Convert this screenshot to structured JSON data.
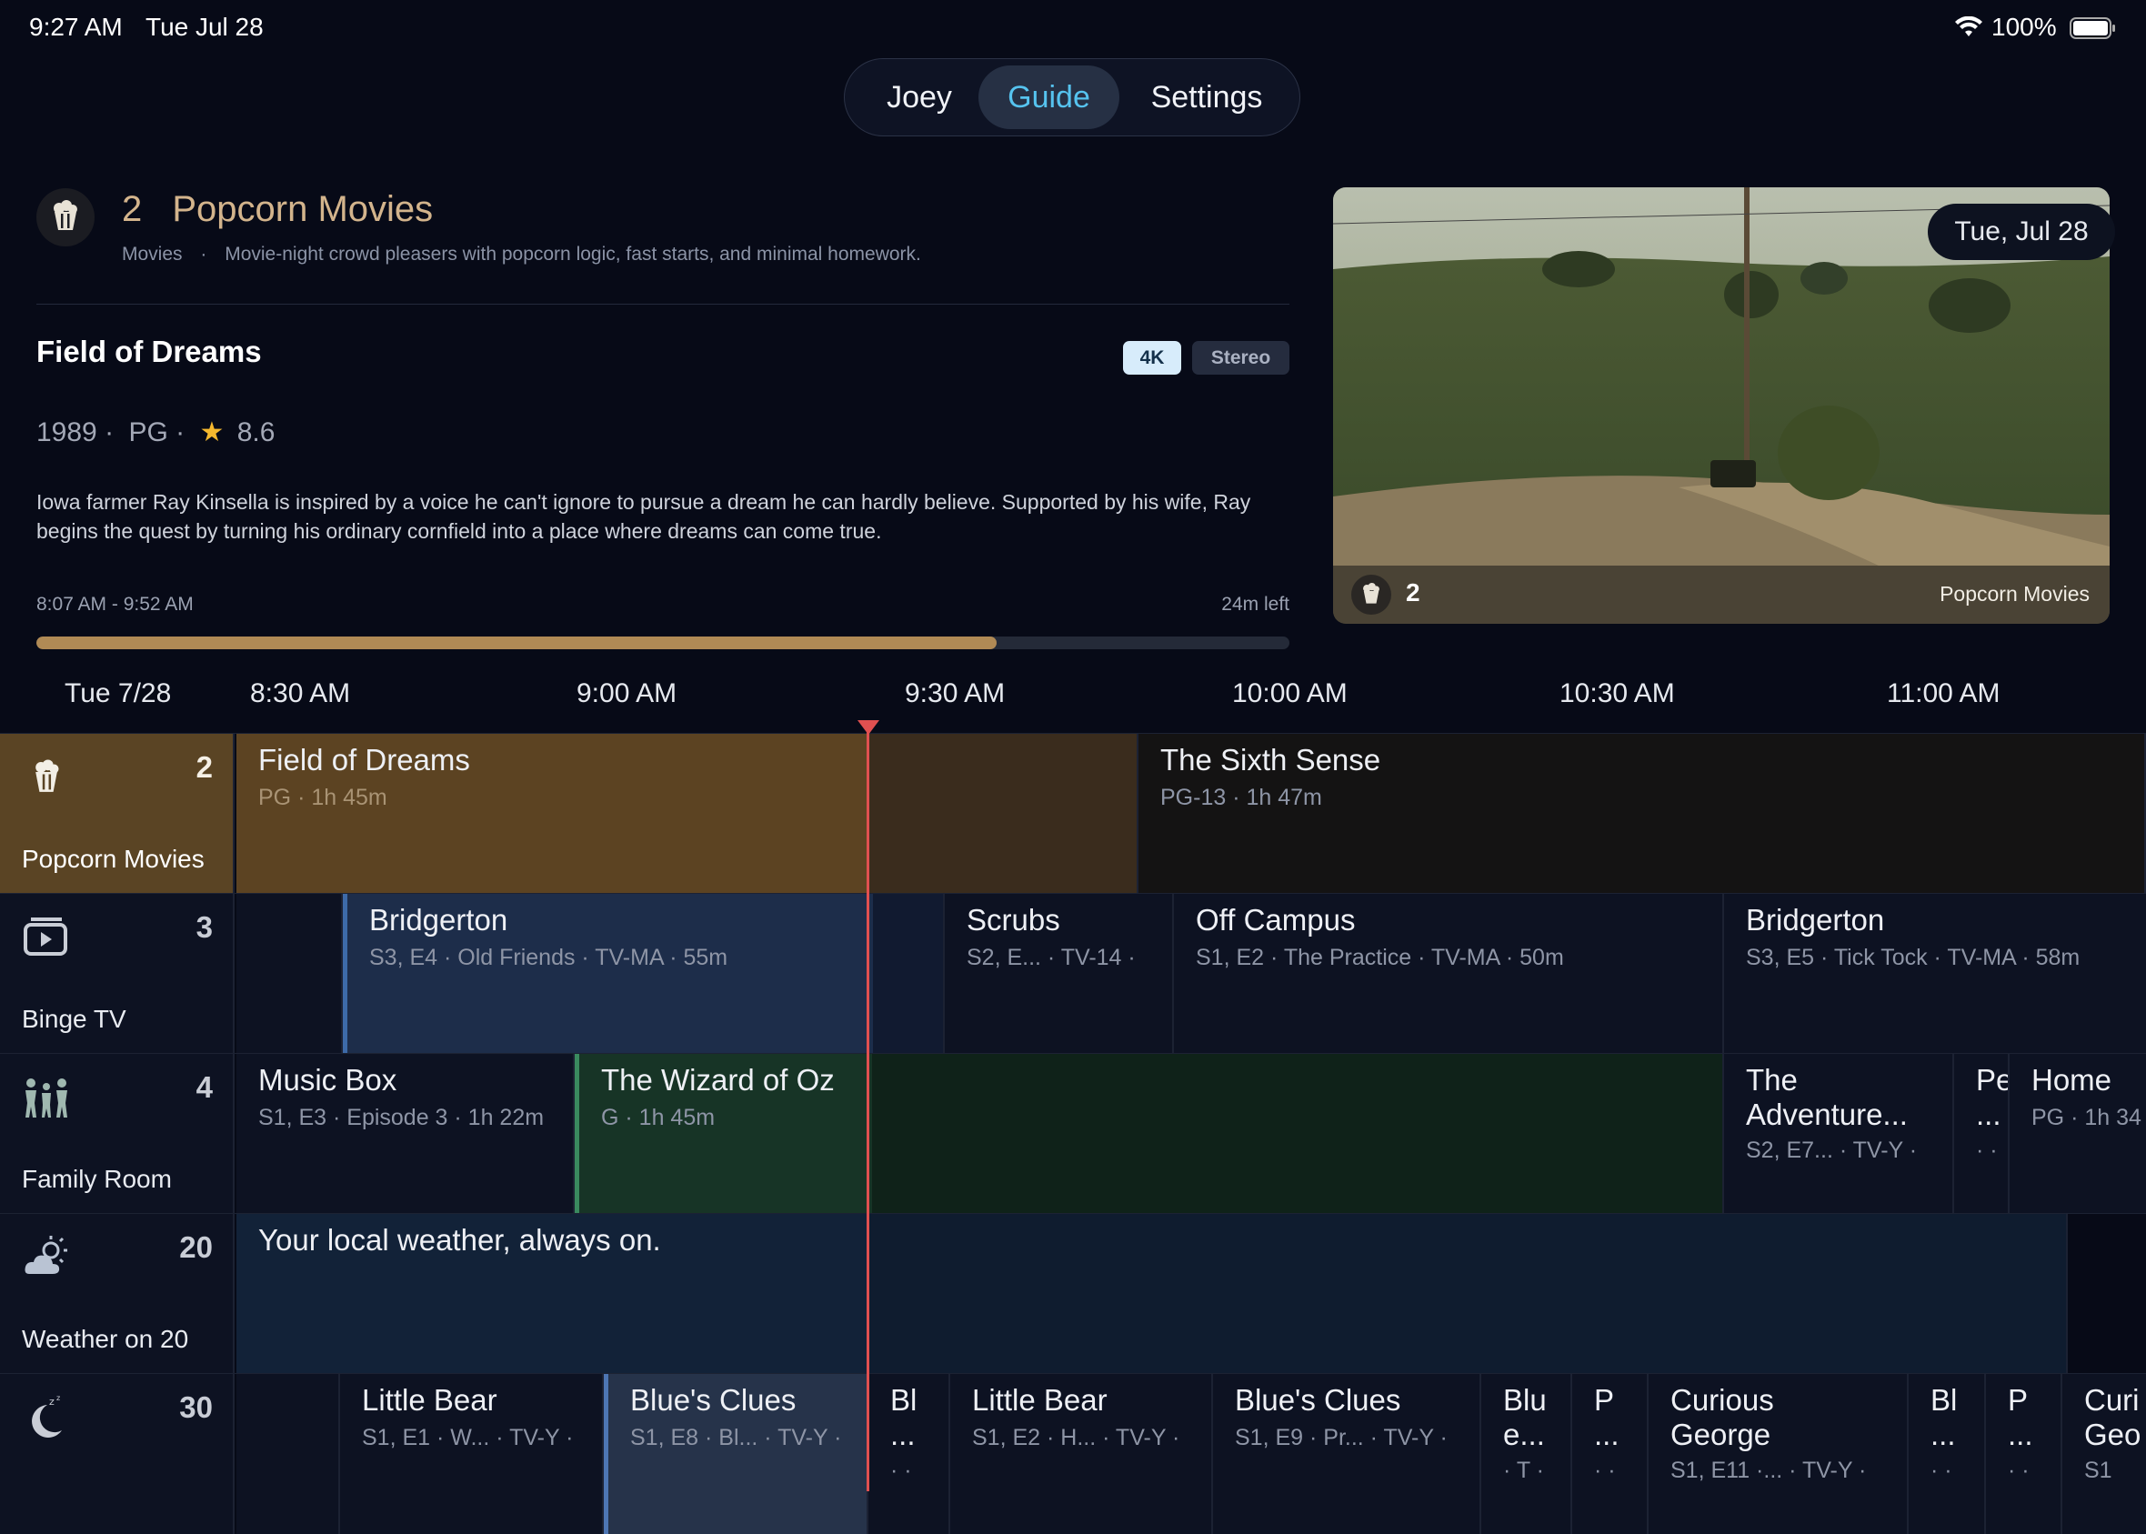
{
  "status": {
    "time": "9:27 AM",
    "date": "Tue Jul 28",
    "battery": "100%",
    "wifi_icon": "wifi-icon",
    "battery_icon": "battery-icon"
  },
  "nav": {
    "tabs": [
      "Joey",
      "Guide",
      "Settings"
    ],
    "active": "Guide"
  },
  "channel": {
    "number": "2",
    "name": "Popcorn Movies",
    "genre": "Movies",
    "separator": "·",
    "description": "Movie-night crowd pleasers with popcorn logic, fast starts, and minimal homework.",
    "icon": "popcorn-icon"
  },
  "program": {
    "title": "Field of Dreams",
    "badges": [
      "4K",
      "Stereo"
    ],
    "year": "1989",
    "rating": "PG",
    "score": "8.6",
    "dot": "·",
    "synopsis": "Iowa farmer Ray Kinsella is inspired by a voice he can't ignore to pursue a dream he can hardly believe. Supported by his wife, Ray begins the quest by turning his ordinary cornfield into a place where dreams can come true.",
    "time_range": "8:07 AM - 9:52 AM",
    "time_left": "24m left",
    "progress": 0.766
  },
  "preview": {
    "date": "Tue, Jul 28",
    "channel_number": "2",
    "channel_name": "Popcorn Movies"
  },
  "guide": {
    "date": "Tue 7/28",
    "times": [
      "8:30 AM",
      "9:00 AM",
      "9:30 AM",
      "10:00 AM",
      "10:30 AM",
      "11:00 AM"
    ],
    "rows": [
      {
        "number": "2",
        "name": "Popcorn Movies",
        "icon": "popcorn-icon",
        "programs": [
          {
            "title": "Field of Dreams",
            "sub": "PG · 1h 45m"
          },
          {
            "title": "The Sixth Sense",
            "sub": "PG-13 · 1h 47m"
          }
        ]
      },
      {
        "number": "3",
        "name": "Binge TV",
        "icon": "tv-play-icon",
        "programs": [
          {
            "title": "",
            "sub": ""
          },
          {
            "title": "Bridgerton",
            "sub": "S3, E4 · Old Friends · TV-MA · 55m"
          },
          {
            "title": "Scrubs",
            "sub": "S2, E... · TV-14 ·"
          },
          {
            "title": "Off Campus",
            "sub": "S1, E2 · The Practice · TV-MA · 50m"
          },
          {
            "title": "Bridgerton",
            "sub": "S3, E5 · Tick Tock · TV-MA · 58m"
          }
        ]
      },
      {
        "number": "4",
        "name": "Family Room",
        "icon": "family-icon",
        "programs": [
          {
            "title": "Music Box",
            "sub": "S1, E3 · Episode 3 · 1h 22m"
          },
          {
            "title": "The Wizard of Oz",
            "sub": "G · 1h 45m"
          },
          {
            "title": "The Adventure...",
            "sub": "S2, E7... · TV-Y ·"
          },
          {
            "title": "Pe ...",
            "sub": "· ·"
          },
          {
            "title": "Home",
            "sub": "PG · 1h 34"
          }
        ]
      },
      {
        "number": "20",
        "name": "Weather on 20",
        "icon": "weather-icon",
        "programs": [
          {
            "title": "Your local weather, always on.",
            "sub": ""
          }
        ]
      },
      {
        "number": "30",
        "name": "",
        "icon": "moon-sleep-icon",
        "programs": [
          {
            "title": "",
            "sub": ""
          },
          {
            "title": "Little Bear",
            "sub": "S1, E1 · W... · TV-Y ·"
          },
          {
            "title": "Blue's Clues",
            "sub": "S1, E8 · Bl... · TV-Y ·"
          },
          {
            "title": "Bl ...",
            "sub": "· ·"
          },
          {
            "title": "Little Bear",
            "sub": "S1, E2 · H... · TV-Y ·"
          },
          {
            "title": "Blue's Clues",
            "sub": "S1, E9 · Pr... · TV-Y ·"
          },
          {
            "title": "Blu e...",
            "sub": "· T ·"
          },
          {
            "title": "P ...",
            "sub": "· ·"
          },
          {
            "title": "Curious George",
            "sub": "S1, E11 ·... · TV-Y ·"
          },
          {
            "title": "Bl ...",
            "sub": "· ·"
          },
          {
            "title": "P ...",
            "sub": "· ·"
          },
          {
            "title": "Curi Geo",
            "sub": "S1"
          }
        ]
      }
    ]
  }
}
